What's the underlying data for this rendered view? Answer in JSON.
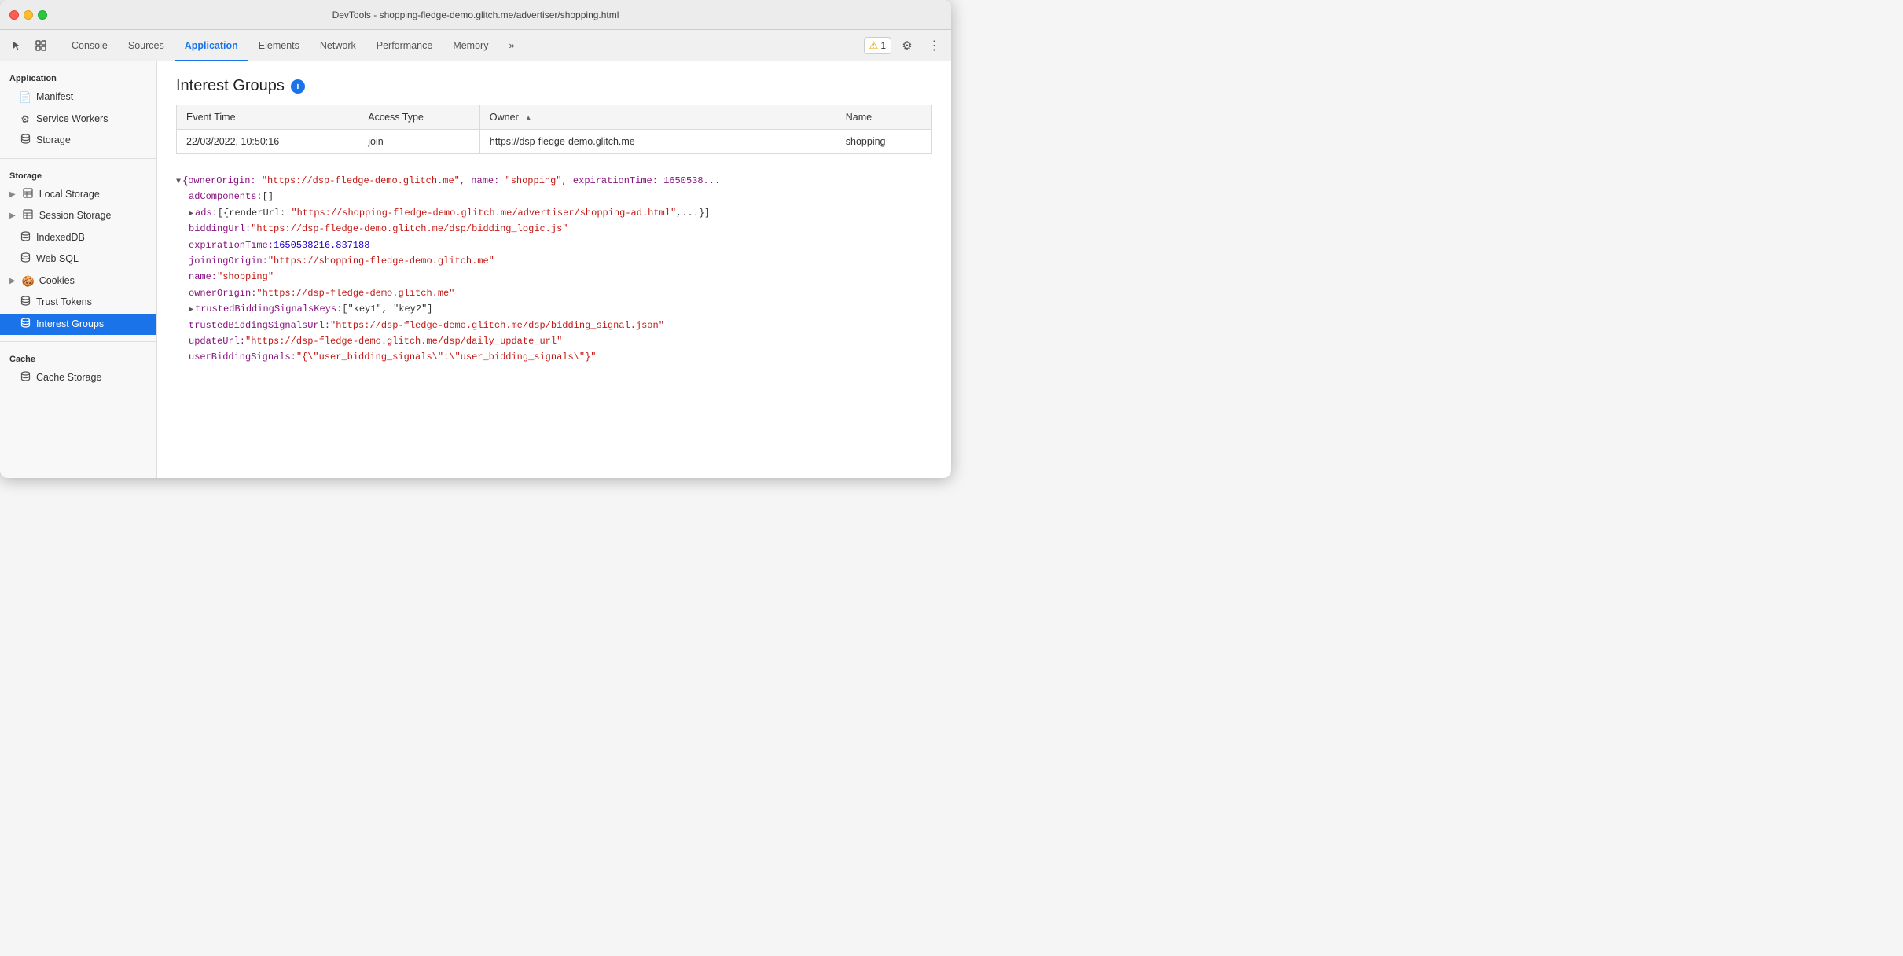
{
  "titlebar": {
    "title": "DevTools - shopping-fledge-demo.glitch.me/advertiser/shopping.html"
  },
  "toolbar": {
    "tabs": [
      {
        "id": "console",
        "label": "Console",
        "active": false
      },
      {
        "id": "sources",
        "label": "Sources",
        "active": false
      },
      {
        "id": "application",
        "label": "Application",
        "active": true
      },
      {
        "id": "elements",
        "label": "Elements",
        "active": false
      },
      {
        "id": "network",
        "label": "Network",
        "active": false
      },
      {
        "id": "performance",
        "label": "Performance",
        "active": false
      },
      {
        "id": "memory",
        "label": "Memory",
        "active": false
      }
    ],
    "more_tabs_label": "»",
    "warning_count": "1",
    "warning_icon": "⚠"
  },
  "sidebar": {
    "sections": [
      {
        "id": "application",
        "title": "Application",
        "items": [
          {
            "id": "manifest",
            "label": "Manifest",
            "icon": "file",
            "active": false
          },
          {
            "id": "service-workers",
            "label": "Service Workers",
            "icon": "gear",
            "active": false
          },
          {
            "id": "storage",
            "label": "Storage",
            "icon": "db",
            "active": false
          }
        ]
      },
      {
        "id": "storage",
        "title": "Storage",
        "items": [
          {
            "id": "local-storage",
            "label": "Local Storage",
            "icon": "table",
            "expandable": true,
            "active": false
          },
          {
            "id": "session-storage",
            "label": "Session Storage",
            "icon": "table",
            "expandable": true,
            "active": false
          },
          {
            "id": "indexeddb",
            "label": "IndexedDB",
            "icon": "db",
            "active": false
          },
          {
            "id": "web-sql",
            "label": "Web SQL",
            "icon": "db",
            "active": false
          },
          {
            "id": "cookies",
            "label": "Cookies",
            "icon": "cookie",
            "expandable": true,
            "active": false
          },
          {
            "id": "trust-tokens",
            "label": "Trust Tokens",
            "icon": "db",
            "active": false
          },
          {
            "id": "interest-groups",
            "label": "Interest Groups",
            "icon": "db",
            "active": true
          }
        ]
      },
      {
        "id": "cache",
        "title": "Cache",
        "items": [
          {
            "id": "cache-storage",
            "label": "Cache Storage",
            "icon": "db",
            "active": false
          }
        ]
      }
    ]
  },
  "main": {
    "title": "Interest Groups",
    "info_tooltip": "i",
    "table": {
      "columns": [
        {
          "id": "event_time",
          "label": "Event Time",
          "sortable": false
        },
        {
          "id": "access_type",
          "label": "Access Type",
          "sortable": false
        },
        {
          "id": "owner",
          "label": "Owner",
          "sortable": true
        },
        {
          "id": "name",
          "label": "Name",
          "sortable": false
        }
      ],
      "rows": [
        {
          "event_time": "22/03/2022, 10:50:16",
          "access_type": "join",
          "owner": "https://dsp-fledge-demo.glitch.me",
          "name": "shopping"
        }
      ]
    },
    "json_viewer": {
      "root_line": "▼ {ownerOrigin: \"https://dsp-fledge-demo.glitch.me\", name: \"shopping\", expirationTime: 1650538...",
      "lines": [
        {
          "indent": 1,
          "type": "key-array",
          "key": "adComponents",
          "value": "[]"
        },
        {
          "indent": 1,
          "type": "expand-key",
          "key": "ads",
          "value": "[{renderUrl: \"https://shopping-fledge-demo.glitch.me/advertiser/shopping-ad.html\",...}]"
        },
        {
          "indent": 1,
          "type": "key-string",
          "key": "biddingUrl",
          "value": "\"https://dsp-fledge-demo.glitch.me/dsp/bidding_logic.js\""
        },
        {
          "indent": 1,
          "type": "key-number",
          "key": "expirationTime",
          "value": "1650538216.837188"
        },
        {
          "indent": 1,
          "type": "key-string",
          "key": "joiningOrigin",
          "value": "\"https://shopping-fledge-demo.glitch.me\""
        },
        {
          "indent": 1,
          "type": "key-string",
          "key": "name",
          "value": "\"shopping\""
        },
        {
          "indent": 1,
          "type": "key-string",
          "key": "ownerOrigin",
          "value": "\"https://dsp-fledge-demo.glitch.me\""
        },
        {
          "indent": 1,
          "type": "expand-key",
          "key": "trustedBiddingSignalsKeys",
          "value": "[\"key1\", \"key2\"]"
        },
        {
          "indent": 1,
          "type": "key-string",
          "key": "trustedBiddingSignalsUrl",
          "value": "\"https://dsp-fledge-demo.glitch.me/dsp/bidding_signal.json\""
        },
        {
          "indent": 1,
          "type": "key-string",
          "key": "updateUrl",
          "value": "\"https://dsp-fledge-demo.glitch.me/dsp/daily_update_url\""
        },
        {
          "indent": 1,
          "type": "key-string",
          "key": "userBiddingSignals",
          "value": "\"{\\\"user_bidding_signals\\\":\\\"user_bidding_signals\\\"}\""
        }
      ]
    }
  }
}
